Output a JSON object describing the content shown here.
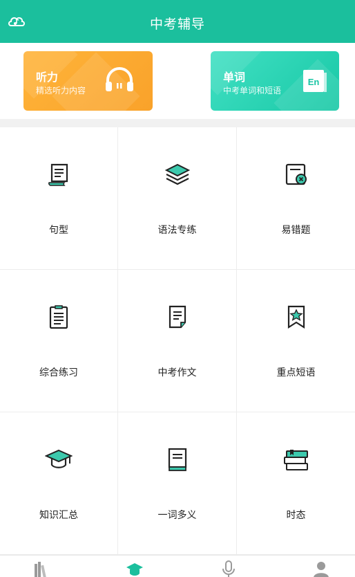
{
  "header": {
    "title": "中考辅导",
    "music_icon": "music-cloud-icon"
  },
  "cards": [
    {
      "title": "听力",
      "subtitle": "精选听力内容",
      "icon": "headphones-icon",
      "color": "#f9a22a"
    },
    {
      "title": "单词",
      "subtitle": "中考单词和短语",
      "icon": "en-book-icon",
      "color": "#1dcaa9"
    }
  ],
  "grid": {
    "items": [
      {
        "label": "句型",
        "icon": "scroll-icon"
      },
      {
        "label": "语法专练",
        "icon": "layers-icon"
      },
      {
        "label": "易错题",
        "icon": "wrong-doc-icon"
      },
      {
        "label": "综合练习",
        "icon": "clipboard-icon"
      },
      {
        "label": "中考作文",
        "icon": "document-icon"
      },
      {
        "label": "重点短语",
        "icon": "star-bookmark-icon"
      },
      {
        "label": "知识汇总",
        "icon": "graduation-cap-icon"
      },
      {
        "label": "一词多义",
        "icon": "book-icon"
      },
      {
        "label": "时态",
        "icon": "books-stack-icon"
      }
    ]
  },
  "tabbar": {
    "tabs": [
      {
        "icon": "bookshelf-icon",
        "active": false
      },
      {
        "icon": "graduation-cap-icon",
        "active": true
      },
      {
        "icon": "microphone-icon",
        "active": false
      },
      {
        "icon": "user-icon",
        "active": false
      }
    ]
  },
  "colors": {
    "brand": "#1bbf9d",
    "accent_orange": "#f9a22a",
    "icon_teal": "#3cc9ad",
    "icon_dark": "#222222"
  }
}
